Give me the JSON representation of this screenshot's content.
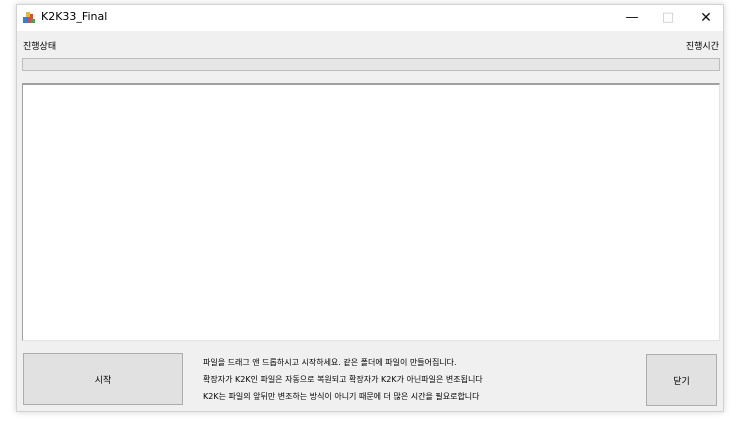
{
  "window": {
    "title": "K2K33_Final",
    "minimize_glyph": "—",
    "maximize_glyph": "□",
    "close_glyph": "✕"
  },
  "status": {
    "progress_label": "진행상태",
    "time_label": "진행시간",
    "progress_fraction": 0
  },
  "buttons": {
    "start_label": "시작",
    "close_label": "닫기"
  },
  "info_lines": [
    "파일을 드래그 앤 드롭하시고 시작하세요. 같은 폴더에 파일이 만들어집니다.",
    "확장자가 K2K인 파일은 자동으로 복원되고 확장자가 K2K가 아닌파일은 변조됩니다",
    "K2K는 파일의 앞뒤만 변조하는 방식이 아니기 때문에 더 많은 시간을 필요로합니다"
  ],
  "icons": {
    "app": "app-icon"
  }
}
